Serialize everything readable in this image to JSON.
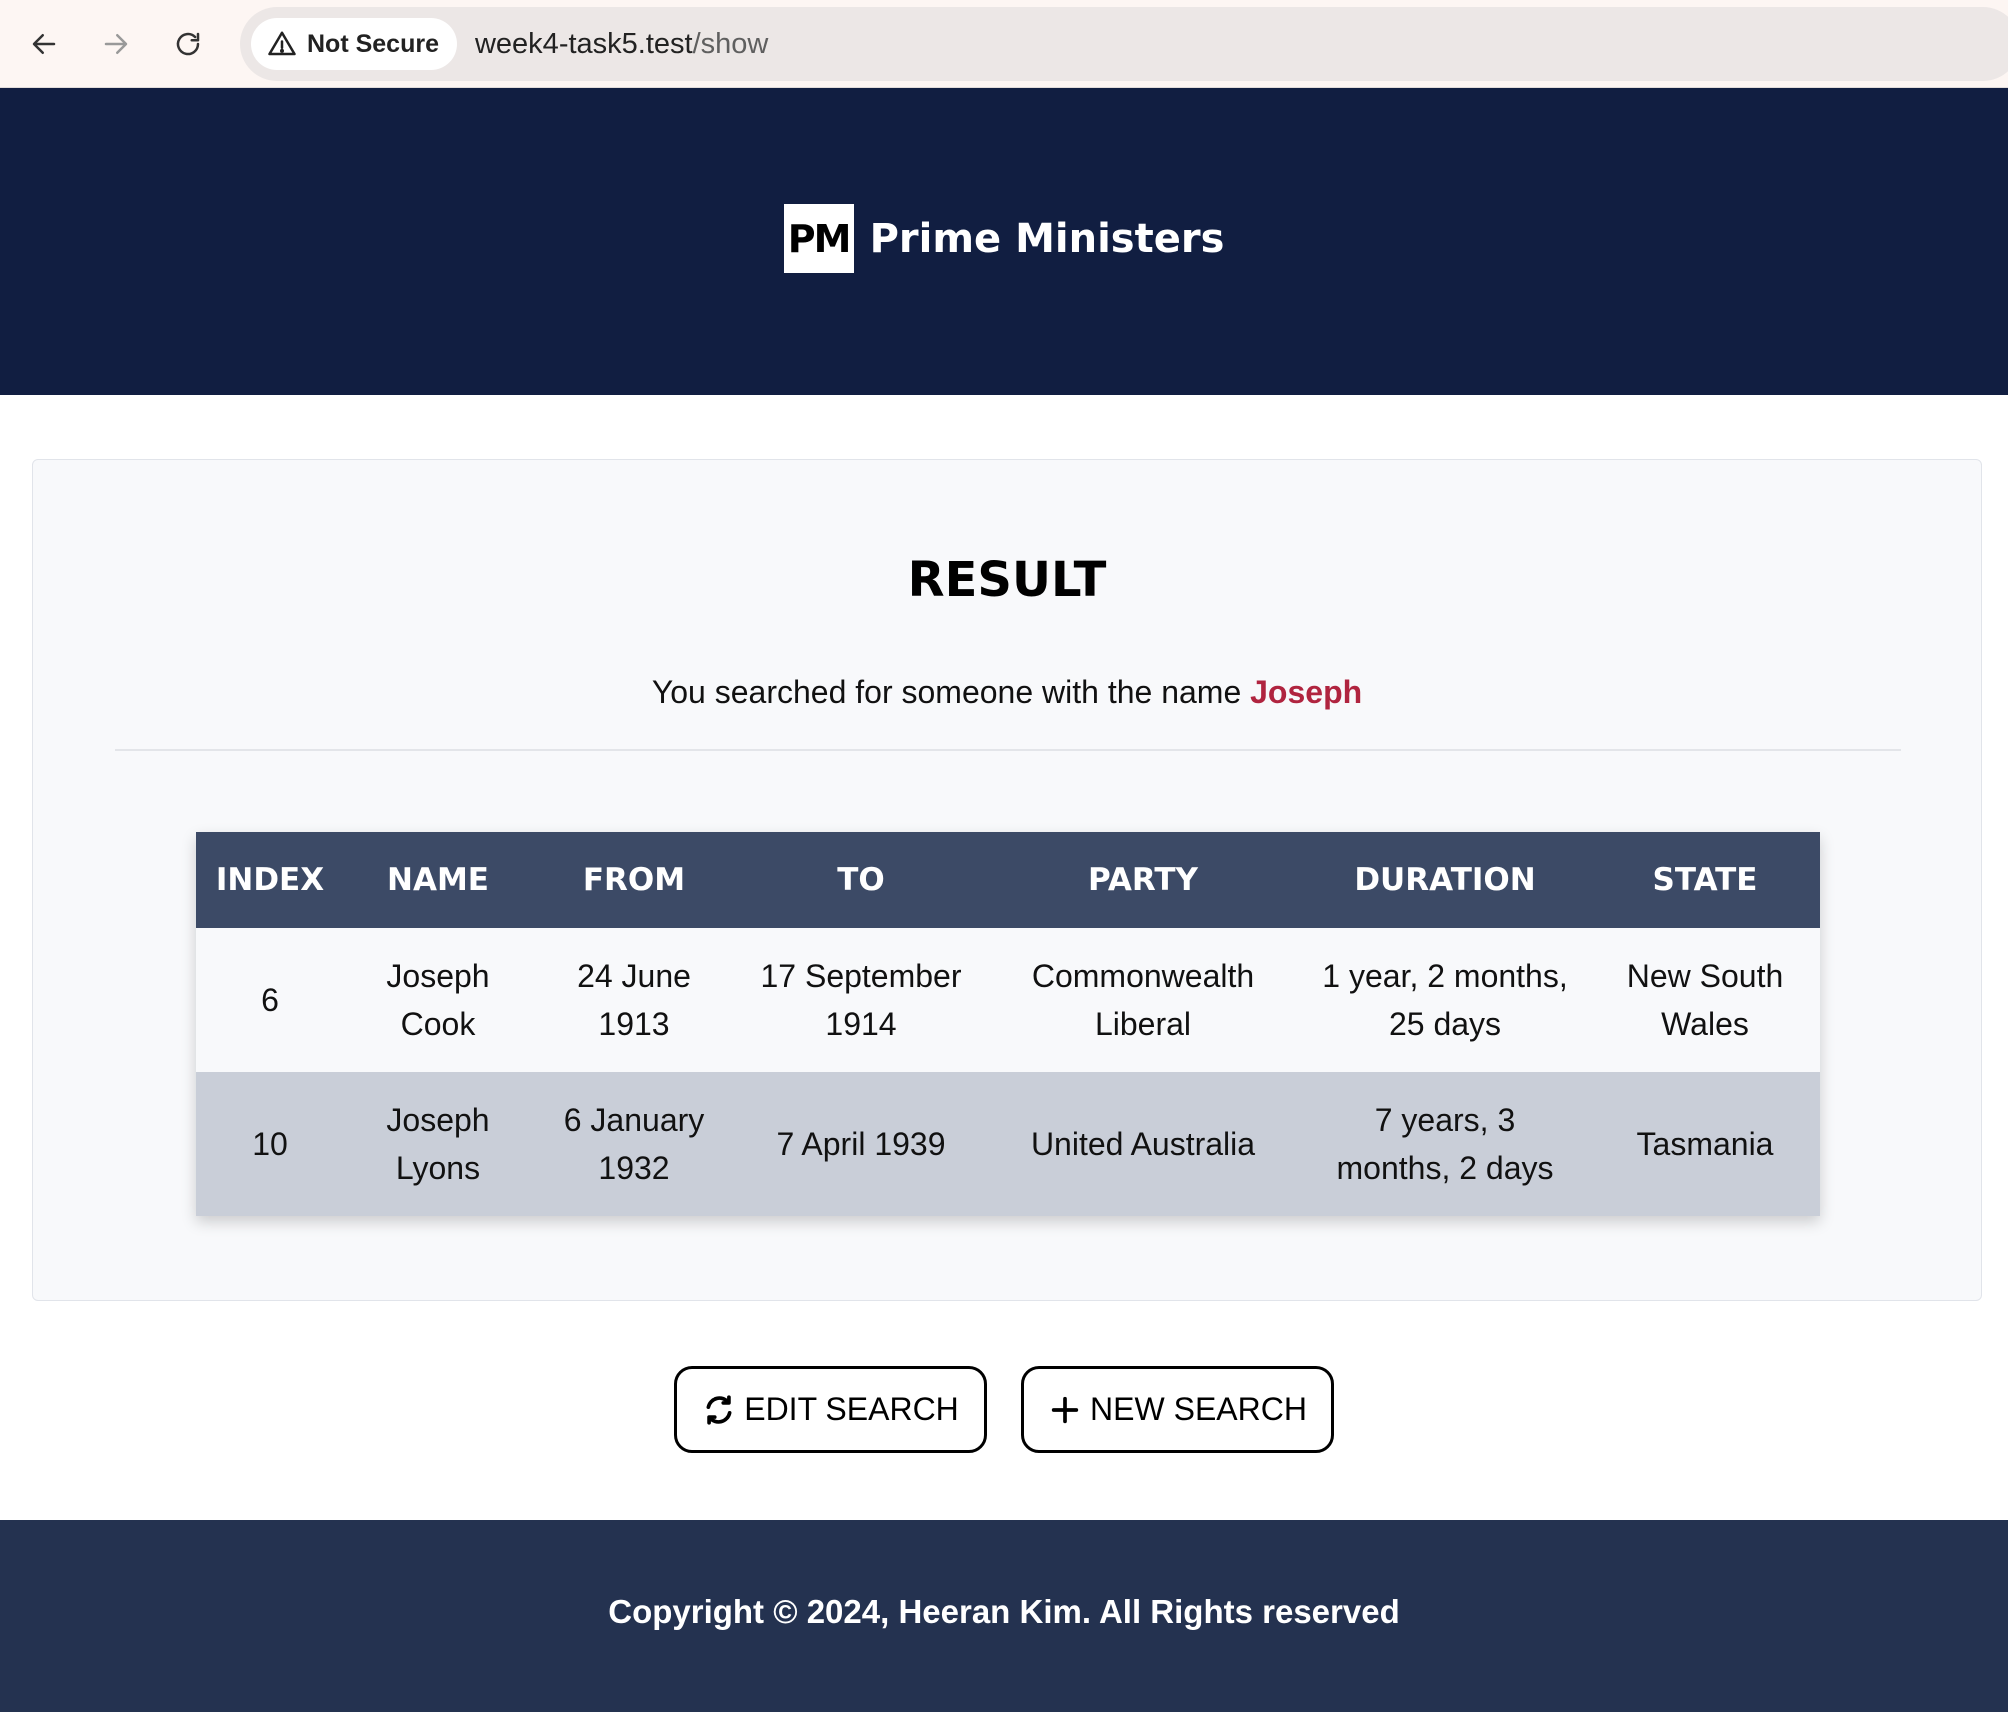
{
  "browser": {
    "security_label": "Not Secure",
    "url_host": "week4-task5.test",
    "url_path": "/show"
  },
  "header": {
    "logo_text": "PM",
    "site_name": "Prime Ministers"
  },
  "result": {
    "title": "RESULT",
    "message_prefix": "You searched for someone with the name ",
    "search_term": "Joseph"
  },
  "table": {
    "headers": [
      "INDEX",
      "NAME",
      "FROM",
      "TO",
      "PARTY",
      "DURATION",
      "STATE"
    ],
    "rows": [
      {
        "index": "6",
        "name": "Joseph Cook",
        "from": "24 June 1913",
        "to": "17 September 1914",
        "party": "Commonwealth Liberal",
        "duration": "1 year, 2 months, 25 days",
        "state": "New South Wales"
      },
      {
        "index": "10",
        "name": "Joseph Lyons",
        "from": "6 January 1932",
        "to": "7 April 1939",
        "party": "United Australia",
        "duration": "7 years, 3 months, 2 days",
        "state": "Tasmania"
      }
    ]
  },
  "actions": {
    "edit_label": "EDIT SEARCH",
    "new_label": "NEW SEARCH"
  },
  "footer": {
    "copyright": "Copyright © 2024, Heeran Kim. All Rights reserved"
  },
  "colors": {
    "header_bg": "#111e41",
    "footer_bg": "#243250",
    "table_header_bg": "#3c4a66",
    "highlight": "#b0243f"
  },
  "icons": {
    "back": "arrow-left-icon",
    "forward": "arrow-right-icon",
    "reload": "reload-icon",
    "warning": "warning-triangle-icon",
    "edit": "sync-icon",
    "new": "plus-icon"
  }
}
